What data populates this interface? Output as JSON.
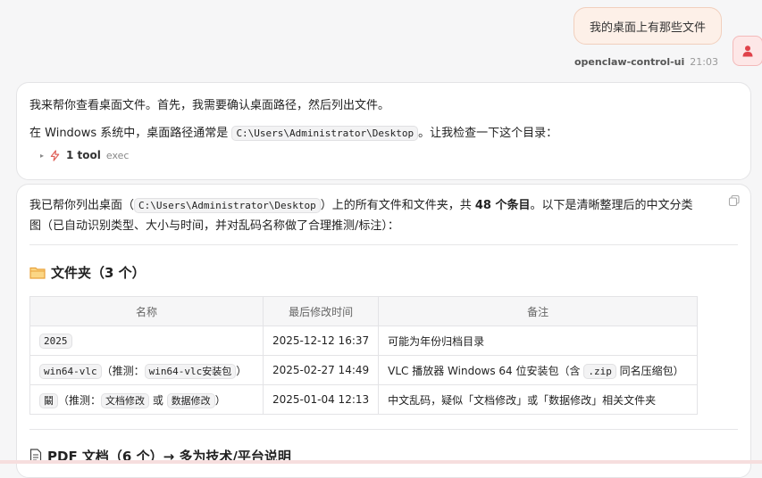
{
  "user_message": {
    "text": "我的桌面上有那些文件",
    "sender": "openclaw-control-ui",
    "time": "21:03"
  },
  "assistant_message_1": {
    "para1": "我来帮你查看桌面文件。首先，我需要确认桌面路径，然后列出文件。",
    "para2_before": "在 Windows 系统中，桌面路径通常是",
    "para2_code": "C:\\Users\\Administrator\\Desktop",
    "para2_after": "。让我检查一下这个目录：",
    "tool_label": "1 tool",
    "tool_name": "exec"
  },
  "assistant_message_2": {
    "intro_1": "我已帮你列出桌面（",
    "intro_code": "C:\\Users\\Administrator\\Desktop",
    "intro_2": "）上的所有文件和文件夹，共",
    "intro_count": "48 个条目",
    "intro_3": "。以下是清晰整理后的中文分类",
    "intro_line2": "图（已自动识别类型、大小与时间，并对乱码名称做了合理推测/标注）：",
    "folders_heading": "文件夹（3 个）",
    "table": {
      "headers": [
        "名称",
        "最后修改时间",
        "备注"
      ],
      "rows": [
        {
          "name_code": "2025",
          "guess_prefix": "",
          "guess_code_1": "",
          "guess_or": "",
          "guess_code_2": "",
          "guess_suffix": "",
          "modified": "2025-12-12 16:37",
          "note": "可能为年份归档目录"
        },
        {
          "name_code": "win64-vlc",
          "guess_prefix": "（推测：",
          "guess_code_1": "win64-vlc安装包",
          "guess_or": "",
          "guess_code_2": "",
          "guess_suffix": "）",
          "modified": "2025-02-27 14:49",
          "note": "VLC 播放器 Windows 64 位安装包（含",
          "note_code": ".zip",
          "note_after": "同名压缩包）"
        },
        {
          "name_code": "鬫",
          "guess_prefix": "（推测：",
          "guess_code_1": "文档修改",
          "guess_or": "或",
          "guess_code_2": "数据修改",
          "guess_suffix": "）",
          "modified": "2025-01-04 12:13",
          "note": "中文乱码，疑似「文档修改」或「数据修改」相关文件夹"
        }
      ]
    },
    "pdf_heading": "PDF 文档（6 个）→ 多为技术/平台说明"
  },
  "icons": {
    "user": "person-icon",
    "tool": "lightning-icon",
    "copy": "copy-icon",
    "folder": "folder-icon",
    "pdf": "document-icon"
  },
  "colors": {
    "user_bubble_bg": "#fdf0e8",
    "tool_icon": "#e0625a",
    "avatar_icon": "#e0424a",
    "folder_icon": "#e9a23b"
  }
}
